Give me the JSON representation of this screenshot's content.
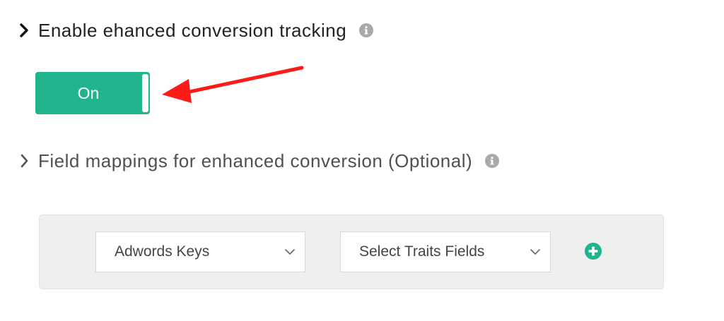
{
  "tracking_section": {
    "title": "Enable ehanced conversion tracking",
    "chevron_icon": "chevron-right-icon",
    "info_icon": "info-circle-icon"
  },
  "toggle": {
    "label": "On",
    "state": "on",
    "color": "#1fb38e"
  },
  "annotation": {
    "arrow_icon": "red-arrow-icon",
    "color": "#ff1a1a"
  },
  "mapping_section": {
    "title": "Field mappings for enhanced conversion (Optional)",
    "chevron_icon": "chevron-right-icon",
    "info_icon": "info-circle-icon"
  },
  "mapping_row": {
    "adwords_select": {
      "value": "Adwords Keys",
      "icon": "chevron-down-icon"
    },
    "traits_select": {
      "value": "Select Traits Fields",
      "icon": "chevron-down-icon"
    },
    "add_button": {
      "icon": "plus-circle-icon",
      "color": "#1fb38e"
    }
  }
}
